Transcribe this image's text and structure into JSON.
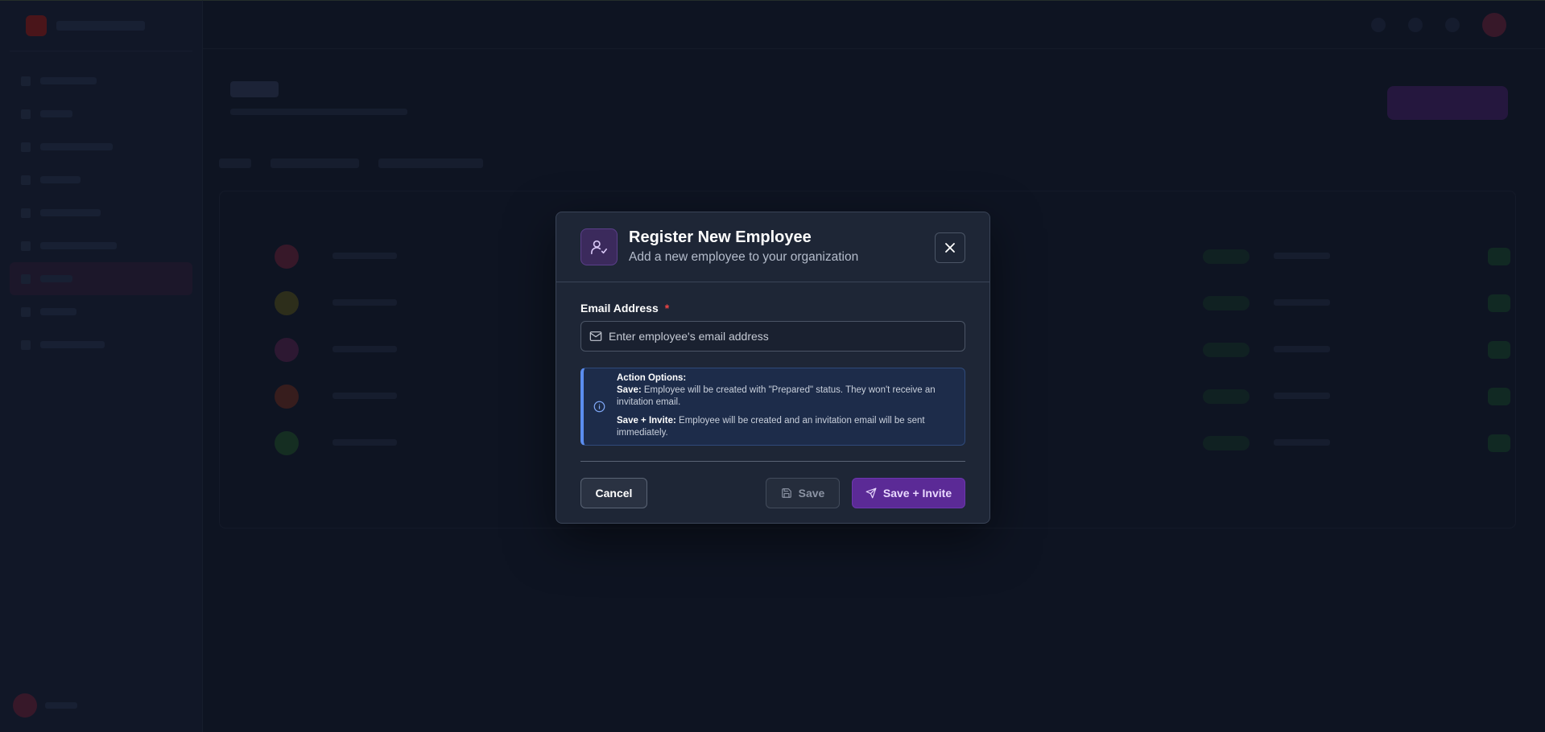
{
  "modal": {
    "title": "Register New Employee",
    "subtitle": "Add a new employee to your organization",
    "header_icon": "user-check-icon",
    "close_icon": "close-icon"
  },
  "form": {
    "email_label": "Email Address",
    "required_marker": "*",
    "email_placeholder": "Enter employee's email address",
    "email_value": "",
    "email_icon": "mail-icon"
  },
  "info": {
    "icon": "info-icon",
    "heading": "Action Options:",
    "save_term": "Save:",
    "save_desc": "Employee will be created with \"Prepared\" status. They won't receive an invitation email.",
    "invite_term": "Save + Invite:",
    "invite_desc": "Employee will be created and an invitation email will be sent immediately."
  },
  "buttons": {
    "cancel": "Cancel",
    "save": "Save",
    "save_icon": "floppy-disk-icon",
    "save_invite": "Save + Invite",
    "save_invite_icon": "send-icon"
  },
  "colors": {
    "accent": "#5b2a96",
    "info_border": "#5b8def",
    "required": "#ef4444"
  }
}
